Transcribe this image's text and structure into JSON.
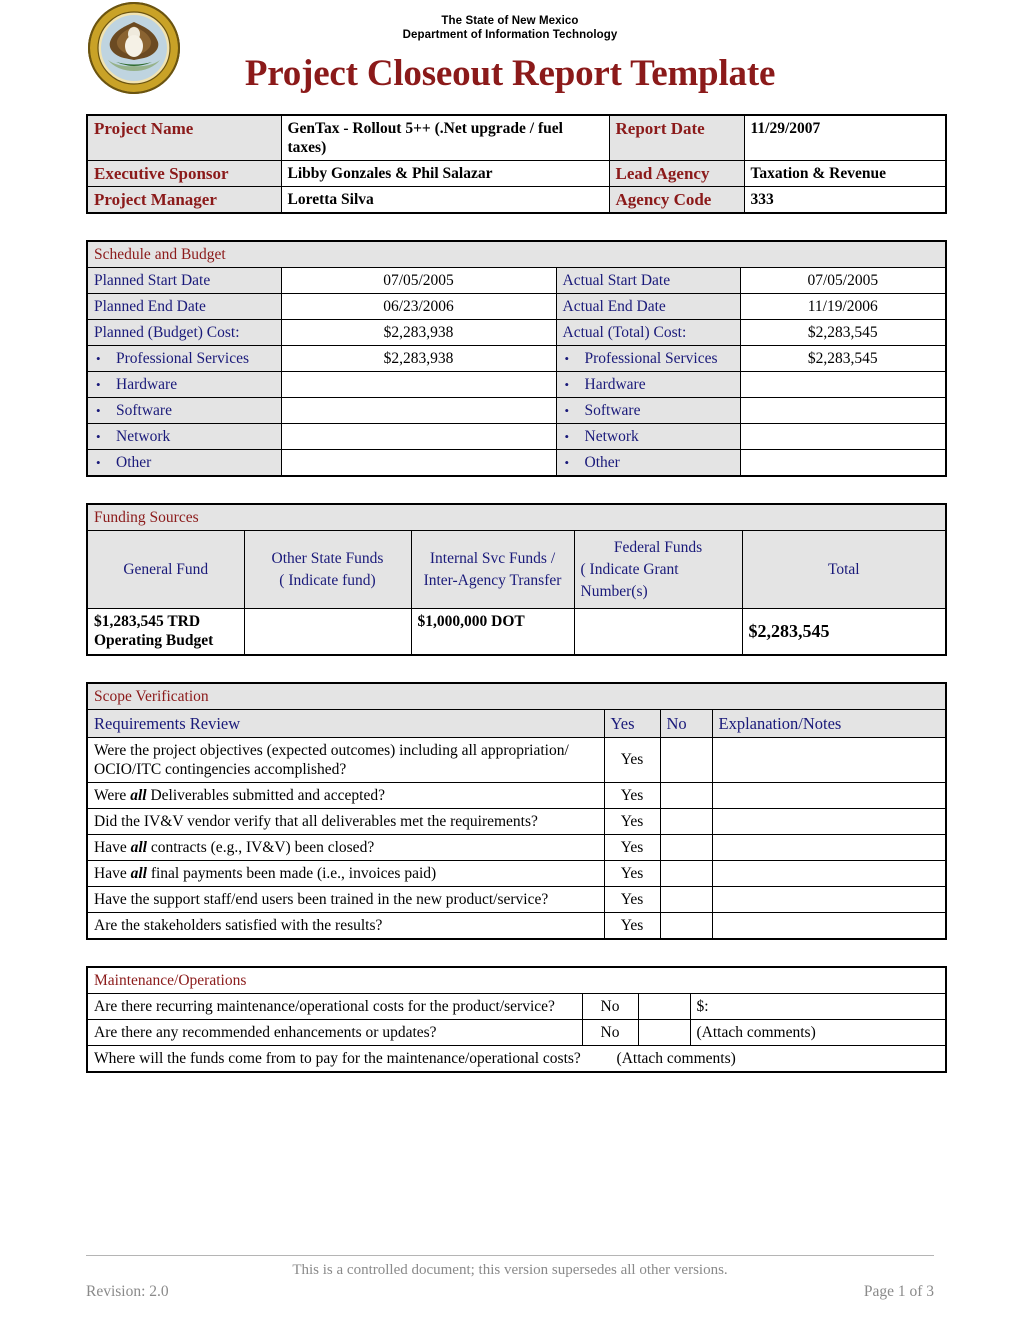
{
  "header": {
    "seal_alt": "new-mexico-state-seal",
    "org_line1": "The State of New Mexico",
    "org_line2": "Department of Information Technology",
    "title": "Project Closeout Report Template",
    "title_color": "#8b1a1a"
  },
  "project_info": {
    "rows": [
      {
        "label1": "Project Name",
        "value1": "GenTax - Rollout 5++  (.Net upgrade / fuel taxes)",
        "label2": "Report Date",
        "value2": "11/29/2007"
      },
      {
        "label1": "Executive Sponsor",
        "value1": "Libby Gonzales & Phil Salazar",
        "label2": "Lead Agency",
        "value2": "Taxation & Revenue"
      },
      {
        "label1": "Project Manager",
        "value1": "Loretta Silva",
        "label2": "Agency Code",
        "value2": "333"
      }
    ]
  },
  "schedule_budget": {
    "title": "Schedule and Budget",
    "rows": [
      {
        "label1": "Planned Start Date",
        "value1": "07/05/2005",
        "label2": "Actual Start Date",
        "value2": "07/05/2005"
      },
      {
        "label1": "Planned End Date",
        "value1": "06/23/2006",
        "label2": "Actual End Date",
        "value2": "11/19/2006"
      },
      {
        "label1": "Planned (Budget) Cost:",
        "value1": "$2,283,938",
        "label2": "Actual (Total) Cost:",
        "value2": "$2,283,545"
      }
    ],
    "bullet_rows": [
      {
        "label1": "Professional Services",
        "value1": "$2,283,938",
        "label2": "Professional Services",
        "value2": "$2,283,545"
      },
      {
        "label1": "Hardware",
        "value1": "",
        "label2": "Hardware",
        "value2": ""
      },
      {
        "label1": "Software",
        "value1": "",
        "label2": "Software",
        "value2": ""
      },
      {
        "label1": "Network",
        "value1": "",
        "label2": "Network",
        "value2": ""
      },
      {
        "label1": "Other",
        "value1": "",
        "label2": "Other",
        "value2": ""
      }
    ],
    "bullet_glyph": "•"
  },
  "funding_sources": {
    "title": "Funding Sources",
    "headers": [
      "General Fund",
      "Other State Funds ( Indicate fund)",
      "Internal Svc Funds / Inter-Agency Transfer",
      "Federal Funds ( Indicate Grant Number(s)",
      "Total"
    ],
    "header_parts": {
      "other_state_l1": "Other State Funds",
      "other_state_l2": "( Indicate fund)",
      "internal_l1": "Internal Svc Funds /",
      "internal_l2": "Inter-Agency Transfer",
      "federal_l1": "Federal Funds",
      "federal_l2": "( Indicate Grant",
      "federal_l3": "Number(s)"
    },
    "values": {
      "general_fund_l1": "$1,283,545 TRD",
      "general_fund_l2": "Operating Budget",
      "other_state": "",
      "internal_svc": "$1,000,000 DOT",
      "federal": "",
      "total": "$2,283,545"
    }
  },
  "scope_verification": {
    "title": "Scope Verification",
    "col_headers": {
      "requirements": "Requirements Review",
      "yes": "Yes",
      "no": "No",
      "notes": "Explanation/Notes"
    },
    "rows": [
      {
        "question": "Were the project objectives (expected outcomes) including all appropriation/ OCIO/ITC contingencies accomplished?",
        "yes": "Yes",
        "no": "",
        "notes": ""
      },
      {
        "question": "Were all Deliverables submitted and accepted?",
        "emphasis": "all",
        "yes": "Yes",
        "no": "",
        "notes": ""
      },
      {
        "question": "Did the IV&V vendor verify that all deliverables met the requirements?",
        "yes": "Yes",
        "no": "",
        "notes": ""
      },
      {
        "question": "Have all contracts (e.g., IV&V) been closed?",
        "emphasis": "all",
        "yes": "Yes",
        "no": "",
        "notes": ""
      },
      {
        "question": "Have all final payments been made (i.e., invoices paid)",
        "emphasis": "all",
        "yes": "Yes",
        "no": "",
        "notes": ""
      },
      {
        "question": "Have the support staff/end users been trained in the new product/service?",
        "yes": "Yes",
        "no": "",
        "notes": ""
      },
      {
        "question": "Are the stakeholders satisfied with the results?",
        "yes": "Yes",
        "no": "",
        "notes": ""
      }
    ]
  },
  "maintenance_operations": {
    "title": "Maintenance/Operations",
    "rows": [
      {
        "question": "Are there recurring maintenance/operational costs for the product/service?",
        "yes": "No",
        "no": "",
        "notes": "$:"
      },
      {
        "question": "Are there any recommended enhancements or updates?",
        "yes": "No",
        "no": "",
        "notes": "(Attach comments)"
      }
    ],
    "full_row": {
      "question": "Where will the funds come from to pay for the maintenance/operational costs?",
      "note": "(Attach comments)"
    }
  },
  "footer": {
    "note": "This is a controlled document; this version supersedes all other versions.",
    "revision": "Revision: 2.0",
    "page": "Page 1 of 3"
  }
}
